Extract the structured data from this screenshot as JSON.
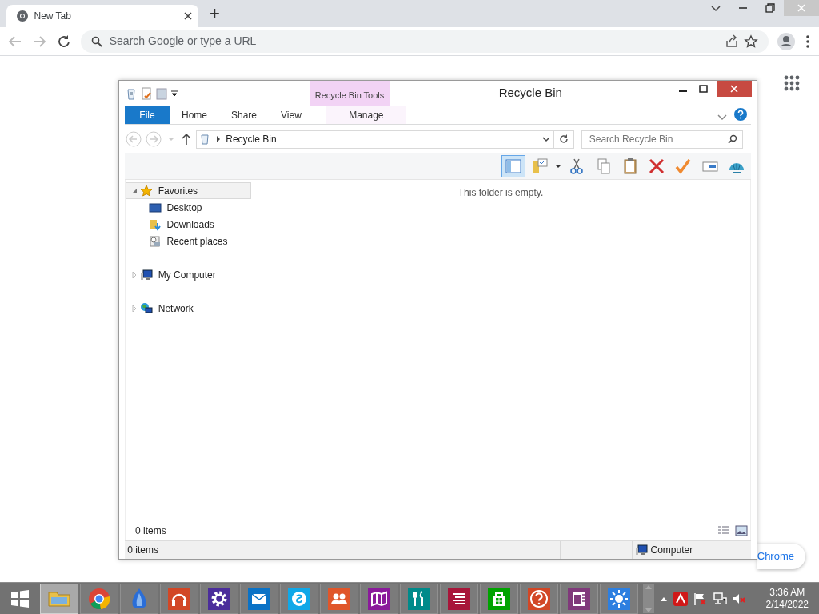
{
  "browser": {
    "tab": {
      "title": "New Tab"
    },
    "new_tab_button": "+",
    "omnibox": {
      "placeholder": "Search Google or type a URL"
    }
  },
  "page": {
    "customize_button": "Chrome"
  },
  "explorer": {
    "title": "Recycle Bin",
    "contextual_group": "Recycle Bin Tools",
    "file_tab": "File",
    "ribbon_tabs": [
      {
        "label": "Home",
        "selected": false
      },
      {
        "label": "Share",
        "selected": false
      },
      {
        "label": "View",
        "selected": false
      },
      {
        "label": "Manage",
        "selected": false,
        "contextual": true
      }
    ],
    "address": "Recycle Bin",
    "search": {
      "placeholder": "Search Recycle Bin"
    },
    "nav": [
      {
        "label": "Favorites",
        "kind": "favorites",
        "expanded": true,
        "selected": true,
        "children": [
          {
            "label": "Desktop",
            "kind": "desktop",
            "selected": false
          },
          {
            "label": "Downloads",
            "kind": "downloads",
            "selected": false
          },
          {
            "label": "Recent places",
            "kind": "recent",
            "selected": false
          }
        ]
      },
      {
        "label": "My Computer",
        "kind": "computer",
        "expanded": false,
        "selected": false
      },
      {
        "label": "Network",
        "kind": "network",
        "expanded": false,
        "selected": false
      }
    ],
    "empty_message": "This folder is empty.",
    "item_count": "0 items",
    "status_bar": {
      "items": "0 items",
      "location": "Computer"
    }
  },
  "taskbar": {
    "apps": [
      {
        "kind": "folder",
        "selected": true
      },
      {
        "kind": "browser",
        "selected": false
      },
      {
        "kind": "flame",
        "selected": false
      },
      {
        "kind": "headphones",
        "selected": false,
        "color": "#d24726"
      },
      {
        "kind": "gear",
        "selected": false,
        "color": "#4b2d9b"
      },
      {
        "kind": "mail",
        "selected": false,
        "color": "#0a72c6"
      },
      {
        "kind": "chat",
        "selected": false,
        "color": "#10a8e8"
      },
      {
        "kind": "people",
        "selected": false,
        "color": "#e0562a"
      },
      {
        "kind": "map",
        "selected": false,
        "color": "#8a1a9b"
      },
      {
        "kind": "food",
        "selected": false,
        "color": "#008a8a"
      },
      {
        "kind": "news",
        "selected": false,
        "color": "#a8163a"
      },
      {
        "kind": "store",
        "selected": false,
        "color": "#00a300"
      },
      {
        "kind": "help",
        "selected": false,
        "color": "#d24726"
      },
      {
        "kind": "note",
        "selected": false,
        "color": "#80397b"
      },
      {
        "kind": "sun",
        "selected": false,
        "color": "#2d7fe0"
      }
    ],
    "clock": {
      "time": "3:36 AM",
      "date": "2/14/2022"
    }
  }
}
